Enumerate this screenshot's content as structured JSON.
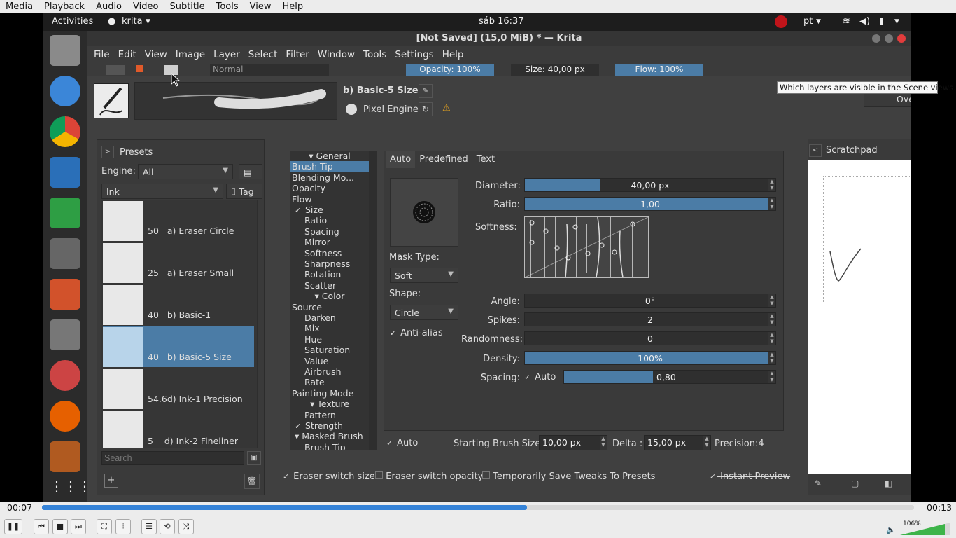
{
  "vlc_menu": [
    "Media",
    "Playback",
    "Audio",
    "Video",
    "Subtitle",
    "Tools",
    "View",
    "Help"
  ],
  "gnome": {
    "activities": "Activities",
    "app": "krita",
    "clock": "sáb 16:37",
    "lang": "pt"
  },
  "krita": {
    "title": "[Not Saved] (15,0 MiB) * — Krita",
    "menu": [
      "File",
      "Edit",
      "View",
      "Image",
      "Layer",
      "Select",
      "Filter",
      "Window",
      "Tools",
      "Settings",
      "Help"
    ],
    "toolbar": {
      "blend": "Normal",
      "opacity": "Opacity: 100%",
      "size": "Size: 40,00 px",
      "flow": "Flow: 100%",
      "overwrite": "Overwr"
    },
    "tooltip": "Which layers are visible in the Scene views."
  },
  "editor": {
    "preset_name": "b) Basic-5 Size",
    "engine_label": "Pixel Engine",
    "presets_label": "Presets",
    "engine_field_label": "Engine:",
    "engine_value": "All",
    "tag_value": "Ink",
    "tag_button": "Tag",
    "search_placeholder": "Search",
    "presets": [
      {
        "size": "50",
        "name": "a) Eraser Circle"
      },
      {
        "size": "25",
        "name": "a) Eraser Small"
      },
      {
        "size": "40",
        "name": "b) Basic-1"
      },
      {
        "size": "40",
        "name": "b) Basic-5 Size"
      },
      {
        "size": "54.6",
        "name": "d) Ink-1 Precision"
      },
      {
        "size": "5",
        "name": "d) Ink-2 Fineliner"
      }
    ],
    "options": [
      "General",
      "Brush Tip",
      "Blending Mo...",
      "Opacity",
      "Flow",
      "Size",
      "Ratio",
      "Spacing",
      "Mirror",
      "Softness",
      "Sharpness",
      "Rotation",
      "Scatter",
      "Color",
      "Source",
      "Darken",
      "Mix",
      "Hue",
      "Saturation",
      "Value",
      "Airbrush",
      "Rate",
      "Painting Mode",
      "Texture",
      "Pattern",
      "Strength",
      "Masked Brush",
      "Brush Tip"
    ],
    "tabs": [
      "Auto",
      "Predefined",
      "Text"
    ],
    "mask_type_label": "Mask Type:",
    "mask_type": "Soft",
    "shape_label": "Shape:",
    "shape": "Circle",
    "antialias": "Anti-alias",
    "params": {
      "diameter": {
        "label": "Diameter:",
        "value": "40,00 px",
        "fill": 0.3
      },
      "ratio": {
        "label": "Ratio:",
        "value": "1,00",
        "fill": 1.0
      },
      "softness": "Softness:",
      "angle": {
        "label": "Angle:",
        "value": "0°",
        "fill": 0
      },
      "spikes": {
        "label": "Spikes:",
        "value": "2",
        "fill": 0
      },
      "randomness": {
        "label": "Randomness:",
        "value": "0",
        "fill": 0
      },
      "density": {
        "label": "Density:",
        "value": "100%",
        "fill": 1.0
      },
      "spacing": {
        "label": "Spacing:",
        "auto": "Auto",
        "value": "0,80",
        "fill": 0.42
      }
    },
    "auto_label": "Auto",
    "start_size_label": "Starting Brush Size:",
    "start_size": "10,00 px",
    "delta_label": "Delta :",
    "delta": "15,00 px",
    "precision": "Precision:4",
    "eraser_size": "Eraser switch size",
    "eraser_opacity": "Eraser switch opacity",
    "temp_save": "Temporarily Save Tweaks To Presets",
    "instant_preview": "Instant Preview",
    "scratchpad": "Scratchpad"
  },
  "vlc": {
    "elapsed": "00:07",
    "total": "00:13",
    "progress": 0.556,
    "volume": "106%"
  }
}
